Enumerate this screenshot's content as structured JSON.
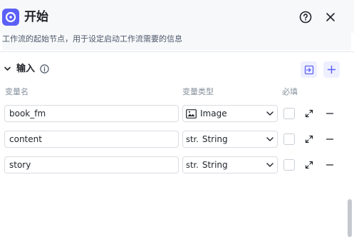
{
  "header": {
    "title": "开始",
    "description": "工作流的起始节点，用于设定启动工作流需要的信息",
    "node_icon": "start-node-icon",
    "help_icon": "question-circle-icon",
    "close_icon": "close-icon"
  },
  "section": {
    "title": "输入",
    "info_icon": "info-icon",
    "import_icon": "import-icon",
    "add_icon": "plus-icon"
  },
  "columns": {
    "name": "变量名",
    "type": "变量类型",
    "required": "必填"
  },
  "variables": [
    {
      "name": "book_fm",
      "type_prefix_icon": "image-icon",
      "type": "Image",
      "required": false
    },
    {
      "name": "content",
      "type_prefix": "str.",
      "type": "String",
      "required": false
    },
    {
      "name": "story",
      "type_prefix": "str.",
      "type": "String",
      "required": false
    }
  ],
  "colors": {
    "accent": "#5b5ff6",
    "accent_bg": "#eef0ff",
    "border": "#d9dce2",
    "muted_text": "#86909c"
  }
}
